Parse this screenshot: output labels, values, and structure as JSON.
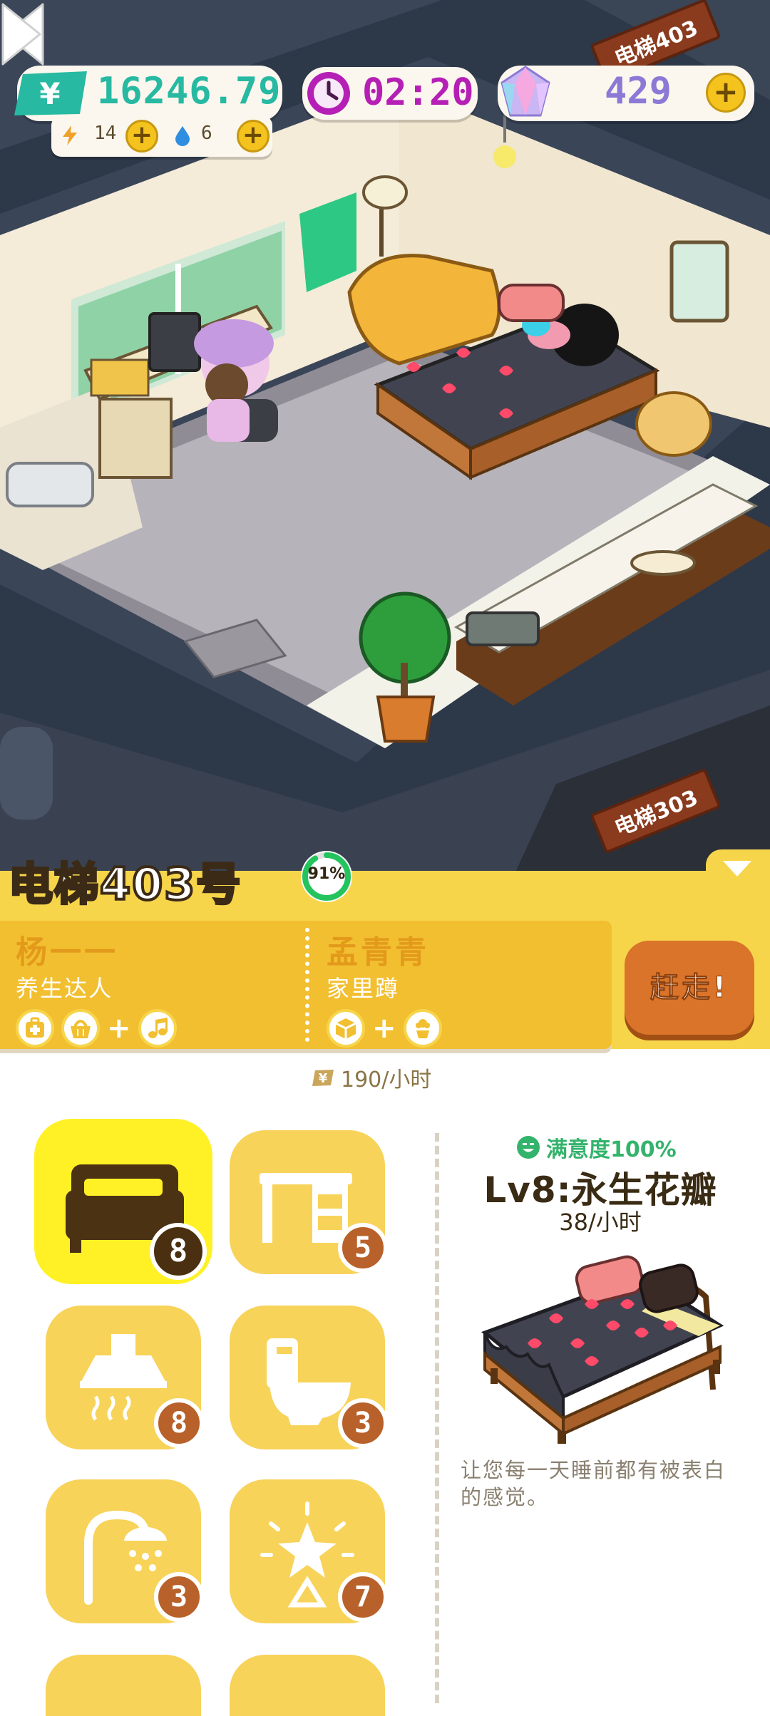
{
  "hud": {
    "money": "16246.79",
    "energy": "14",
    "water": "6",
    "time": "02:20",
    "gems": "429",
    "plus": "+"
  },
  "elevator_signs": {
    "top": "电梯403",
    "bottom": "电梯303"
  },
  "room": {
    "title": "电梯403号",
    "satisfaction_ring": "91%",
    "satisfaction_fraction": 0.91,
    "kick_button": "赶走!",
    "income": "190/小时",
    "tenants": [
      {
        "name": "杨一一",
        "trait": "养生达人",
        "icons": [
          "medkit-icon",
          "basket-icon",
          "music-note-icon"
        ]
      },
      {
        "name": "孟青青",
        "trait": "家里蹲",
        "icons": [
          "package-icon",
          "flower-pot-icon"
        ]
      }
    ]
  },
  "categories": [
    {
      "id": "bed",
      "icon": "bed-icon",
      "count": "8",
      "selected": true
    },
    {
      "id": "desk",
      "icon": "desk-icon",
      "count": "5",
      "selected": false
    },
    {
      "id": "range-hood",
      "icon": "range-hood-icon",
      "count": "8",
      "selected": false
    },
    {
      "id": "toilet",
      "icon": "toilet-icon",
      "count": "3",
      "selected": false
    },
    {
      "id": "shower",
      "icon": "shower-icon",
      "count": "3",
      "selected": false
    },
    {
      "id": "lamp",
      "icon": "lamp-icon",
      "count": "7",
      "selected": false
    }
  ],
  "detail": {
    "satisfaction": "满意度100%",
    "name": "Lv8:永生花瓣",
    "rate": "38/小时",
    "description": "让您每一天睡前都有被表白的感觉。"
  },
  "colors": {
    "money": "#27b9a1",
    "time": "#b51fb5",
    "gems": "#8c79d6",
    "bar": "#f7d54b",
    "tile": "#f8d35a",
    "tile_selected": "#fff126",
    "badge": "#b8612a",
    "kick": "#d9742a"
  }
}
